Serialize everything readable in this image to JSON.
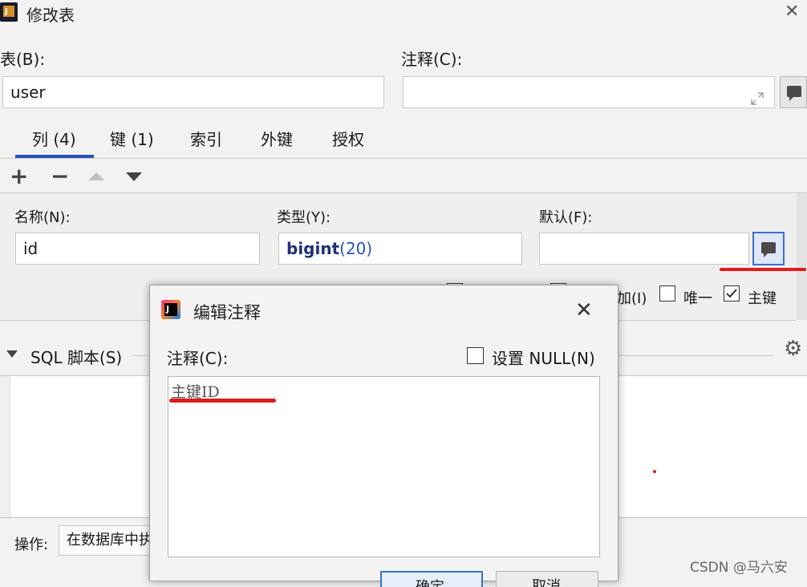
{
  "window": {
    "title": "修改表",
    "close_glyph": "✕"
  },
  "table_field": {
    "label": "表(B):",
    "value": "user"
  },
  "comment_field": {
    "label": "注释(C):",
    "value": ""
  },
  "tabs": [
    {
      "label": "列 (4)",
      "active": true
    },
    {
      "label": "键 (1)"
    },
    {
      "label": "索引"
    },
    {
      "label": "外键"
    },
    {
      "label": "授权"
    }
  ],
  "toolbar": {
    "add": "+",
    "remove": "−"
  },
  "column_form": {
    "name_label": "名称(N):",
    "name_value": "id",
    "type_label": "类型(Y):",
    "type_keyword": "bigint",
    "type_args": "(20)",
    "default_label": "默认(F):",
    "default_value": ""
  },
  "options": {
    "auto_increment_partial": "加(I)",
    "unique_label": "唯一",
    "primary_key_label": "主键"
  },
  "sql_section": {
    "label": "SQL 脚本(S)"
  },
  "operation": {
    "label": "操作:",
    "value": "在数据库中执"
  },
  "dialog": {
    "title": "编辑注释",
    "comment_label": "注释(C):",
    "set_null_label": "设置 NULL(N)",
    "comment_text": "主键ID",
    "ok_partial": "确定",
    "cancel_partial": "取消"
  },
  "watermark": "CSDN @马六安",
  "colors": {
    "accent_blue": "#2a52be",
    "annotation_red": "#e01b1b",
    "type_keyword": "#1f2f7a"
  }
}
